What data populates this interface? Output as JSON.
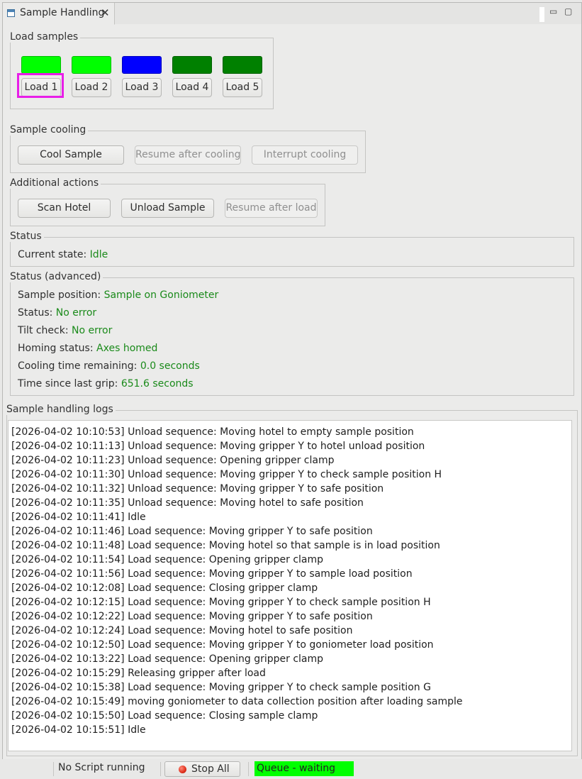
{
  "tab": {
    "title": "Sample Handling",
    "close": "✕"
  },
  "window_controls": {
    "minimize": "▭",
    "maximize": "▢"
  },
  "load_samples": {
    "title": "Load samples",
    "slots": [
      {
        "label": "Load 1",
        "color": "#00ff00"
      },
      {
        "label": "Load 2",
        "color": "#00ff00"
      },
      {
        "label": "Load 3",
        "color": "#0000ff"
      },
      {
        "label": "Load 4",
        "color": "#008000"
      },
      {
        "label": "Load 5",
        "color": "#008000"
      }
    ]
  },
  "sample_cooling": {
    "title": "Sample cooling",
    "cool_sample": "Cool Sample",
    "resume_after_cooling": "Resume after cooling",
    "interrupt_cooling": "Interrupt cooling"
  },
  "additional_actions": {
    "title": "Additional actions",
    "scan_hotel": "Scan Hotel",
    "unload_sample": "Unload Sample",
    "resume_after_load": "Resume after load"
  },
  "status": {
    "title": "Status",
    "current_state_label": "Current state:",
    "current_state_value": "Idle"
  },
  "status_advanced": {
    "title": "Status (advanced)",
    "rows": [
      {
        "label": "Sample position:",
        "value": "Sample on Goniometer"
      },
      {
        "label": "Status:",
        "value": "No error"
      },
      {
        "label": "Tilt check:",
        "value": "No error"
      },
      {
        "label": "Homing status:",
        "value": "Axes homed"
      },
      {
        "label": "Cooling time remaining:",
        "value": "0.0 seconds"
      },
      {
        "label": "Time since last grip:",
        "value": "651.6 seconds"
      }
    ]
  },
  "logs": {
    "title": "Sample handling logs",
    "lines": [
      "[2026-04-02 10:10:53] Unload sequence: Moving hotel to empty sample position",
      "[2026-04-02 10:11:13] Unload sequence: Moving gripper Y to hotel unload position",
      "[2026-04-02 10:11:23] Unload sequence: Opening gripper clamp",
      "[2026-04-02 10:11:30] Unload sequence: Moving gripper Y to check sample position H",
      "[2026-04-02 10:11:32] Unload sequence: Moving gripper Y to safe position",
      "[2026-04-02 10:11:35] Unload sequence: Moving hotel to safe position",
      "[2026-04-02 10:11:41] Idle",
      "[2026-04-02 10:11:46] Load sequence: Moving gripper Y to safe position",
      "[2026-04-02 10:11:48] Load sequence: Moving hotel so that sample is in load position",
      "[2026-04-02 10:11:54] Load sequence: Opening gripper clamp",
      "[2026-04-02 10:11:56] Load sequence: Moving gripper Y to sample load position",
      "[2026-04-02 10:12:08] Load sequence: Closing gripper clamp",
      "[2026-04-02 10:12:15] Load sequence: Moving gripper Y to check sample position H",
      "[2026-04-02 10:12:22] Load sequence: Moving gripper Y to safe position",
      "[2026-04-02 10:12:24] Load sequence: Moving hotel to safe position",
      "[2026-04-02 10:12:50] Load sequence: Moving gripper Y to goniometer load position",
      "[2026-04-02 10:13:22] Load sequence: Opening gripper clamp",
      "[2026-04-02 10:15:29] Releasing gripper after load",
      "[2026-04-02 10:15:38] Load sequence: Moving gripper Y to check sample position G",
      "[2026-04-02 10:15:49] moving goniometer to data collection position after loading sample",
      "[2026-04-02 10:15:50] Load sequence: Closing sample clamp",
      "[2026-04-02 10:15:51] Idle"
    ]
  },
  "statusbar": {
    "script": "No Script running",
    "stop_all": "Stop All",
    "queue": "Queue - waiting",
    "queue_color": "#00ff00"
  }
}
